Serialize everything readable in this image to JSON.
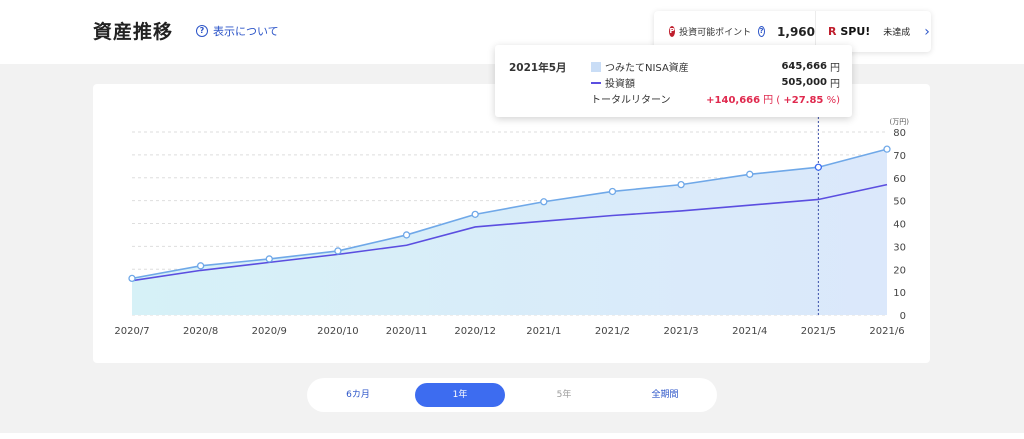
{
  "header": {
    "title": "資産推移",
    "help_label": "表示について"
  },
  "points": {
    "icon_letter": "P",
    "label": "投資可能ポイント",
    "value": "1,960"
  },
  "spu": {
    "logo_r": "R",
    "logo_text": "SPU!",
    "status": "未達成"
  },
  "tooltip": {
    "date": "2021年5月",
    "asset_label": "つみたてNISA資産",
    "asset_value": "645,666",
    "invest_label": "投資額",
    "invest_value": "505,000",
    "unit": "円",
    "return_label": "トータルリターン",
    "return_value": "+140,666",
    "return_pct": "+27.85",
    "return_pct_unit": "%"
  },
  "range_selector": {
    "options": [
      "6カ月",
      "1年",
      "5年",
      "全期間"
    ],
    "selected": "1年",
    "disabled": "5年"
  },
  "colors": {
    "asset_line": "#6fa8e8",
    "asset_fill": "#dbe8fb",
    "invest_line": "#5b4ee0",
    "accent": "#3d6cf0",
    "positive": "#e0294e"
  },
  "chart_data": {
    "type": "area",
    "unit_label": "(万円)",
    "x": [
      "2020/7",
      "2020/8",
      "2020/9",
      "2020/10",
      "2020/11",
      "2020/12",
      "2021/1",
      "2021/2",
      "2021/3",
      "2021/4",
      "2021/5",
      "2021/6"
    ],
    "series": [
      {
        "name": "つみたてNISA資産",
        "values": [
          16,
          21.5,
          24.5,
          28,
          35,
          44,
          49.5,
          54,
          57,
          61.5,
          64.6,
          72.5
        ]
      },
      {
        "name": "投資額",
        "values": [
          15,
          19.5,
          23,
          26.5,
          30.5,
          38.5,
          41,
          43.5,
          45.5,
          48,
          50.5,
          57
        ]
      }
    ],
    "ylim": [
      0,
      80
    ],
    "yticks": [
      0,
      10,
      20,
      30,
      40,
      50,
      60,
      70,
      80
    ],
    "grid": true,
    "highlight_x": "2021/5"
  }
}
